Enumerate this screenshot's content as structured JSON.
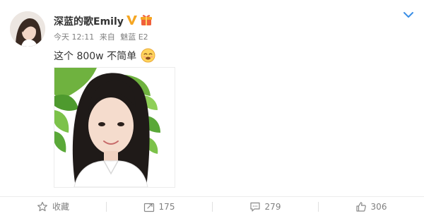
{
  "post": {
    "username": "深蓝的歌Emily",
    "time": "今天 12:11",
    "source_prefix": "来自",
    "source": "魅蓝 E2",
    "text": "这个 800w 不简单",
    "emoji": "sweat-smile-emoji"
  },
  "badges": [
    "vip-v-icon",
    "gift-icon"
  ],
  "actions": {
    "favorite_label": "收藏",
    "repost_count": "175",
    "comment_count": "279",
    "like_count": "306"
  },
  "colors": {
    "accent_orange": "#f5a623",
    "text_main": "#333333",
    "text_meta": "#808080",
    "divider": "#ececec"
  }
}
